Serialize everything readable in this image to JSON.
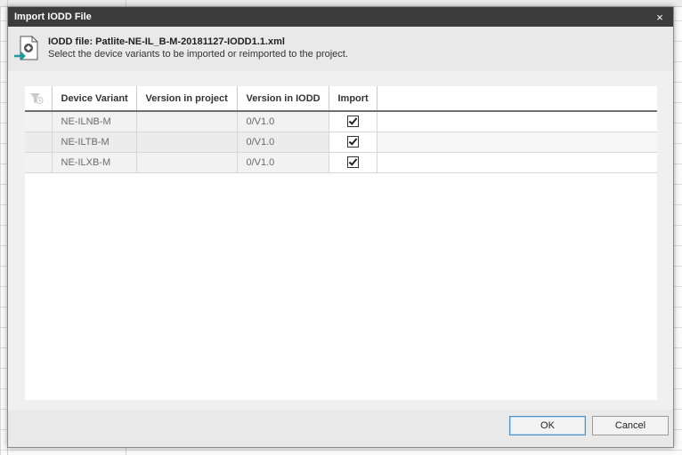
{
  "dialog": {
    "title": "Import IODD File",
    "close_glyph": "×",
    "file_label": "IODD file: Patlite-NE-IL_B-M-20181127-IODD1.1.xml",
    "description": "Select the device variants to be imported or reimported to the project.",
    "icons": {
      "file": "iodd-file-import-icon",
      "filter": "filter-icon",
      "close": "close-icon"
    }
  },
  "table": {
    "columns": [
      "Device Variant",
      "Version in project",
      "Version in IODD",
      "Import"
    ],
    "rows": [
      {
        "device_variant": "NE-ILNB-M",
        "version_in_project": "",
        "version_in_iodd": "0/V1.0",
        "import": true
      },
      {
        "device_variant": "NE-ILTB-M",
        "version_in_project": "",
        "version_in_iodd": "0/V1.0",
        "import": true
      },
      {
        "device_variant": "NE-ILXB-M",
        "version_in_project": "",
        "version_in_iodd": "0/V1.0",
        "import": true
      }
    ]
  },
  "footer": {
    "ok_label": "OK",
    "cancel_label": "Cancel"
  },
  "colors": {
    "titlebar": "#3c3c3c",
    "dialog_bg": "#f0f0f0",
    "accent_teal": "#1a9a9a",
    "ok_focus_border": "#4a90c8"
  }
}
